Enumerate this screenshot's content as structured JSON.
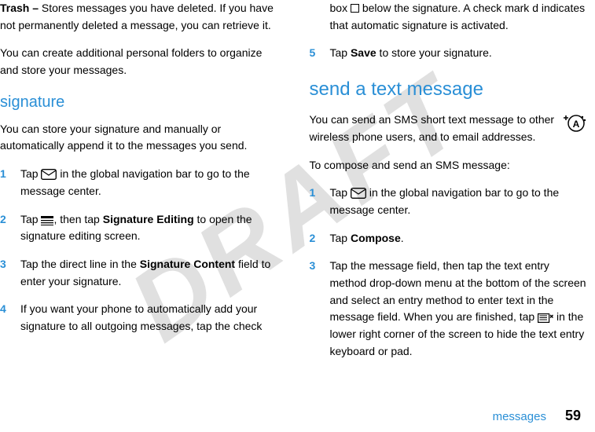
{
  "watermark": "DRAFT",
  "left": {
    "trash_label": "Trash –",
    "trash_desc": " Stores messages you have deleted. If you have not permanently deleted a message, you can retrieve it.",
    "folders_note": "You can create additional personal folders to organize and store your messages.",
    "h_signature": "signature",
    "sig_intro": "You can store your signature and manually or automatically append it to the messages you send.",
    "steps": [
      {
        "n": "1",
        "pre": "Tap ",
        "icon": "env",
        "post": " in the global navigation bar to go to the message center."
      },
      {
        "n": "2",
        "pre": "Tap ",
        "icon": "menu",
        "mid": ", then tap ",
        "bold1": "Signature Editing",
        "post": " to open the signature editing screen."
      },
      {
        "n": "3",
        "pre": "Tap the direct line in the ",
        "bold1": "Signature Content",
        "post": " field to enter your signature."
      },
      {
        "n": "4",
        "pre": "If you want your phone to automatically add your signature to all outgoing messages, tap the check "
      }
    ]
  },
  "right": {
    "cont": "box ",
    "cont_post": " below the signature. A check mark d indicates that automatic signature is activated.",
    "step5": {
      "n": "5",
      "pre": "Tap ",
      "bold1": "Save",
      "post": " to store your signature."
    },
    "h_send": "send a text message",
    "sms_intro": "You can send an SMS short text message to other wireless phone users, and to email addresses.",
    "sms_compose_lead": "To compose and send an SMS message:",
    "steps": [
      {
        "n": "1",
        "pre": "Tap ",
        "icon": "env",
        "post": " in the global navigation bar to go to the message center."
      },
      {
        "n": "2",
        "pre": "Tap ",
        "bold1": "Compose",
        "post": "."
      },
      {
        "n": "3",
        "pre": "Tap the message field, then tap the text entry method drop-down menu at the bottom of the screen and select an entry method to enter text in the message field. When you are finished, tap ",
        "icon": "kbx",
        "post": " in the lower right corner of the screen to hide the text entry keyboard or pad."
      }
    ]
  },
  "footer": {
    "label": "messages",
    "page": "59"
  }
}
